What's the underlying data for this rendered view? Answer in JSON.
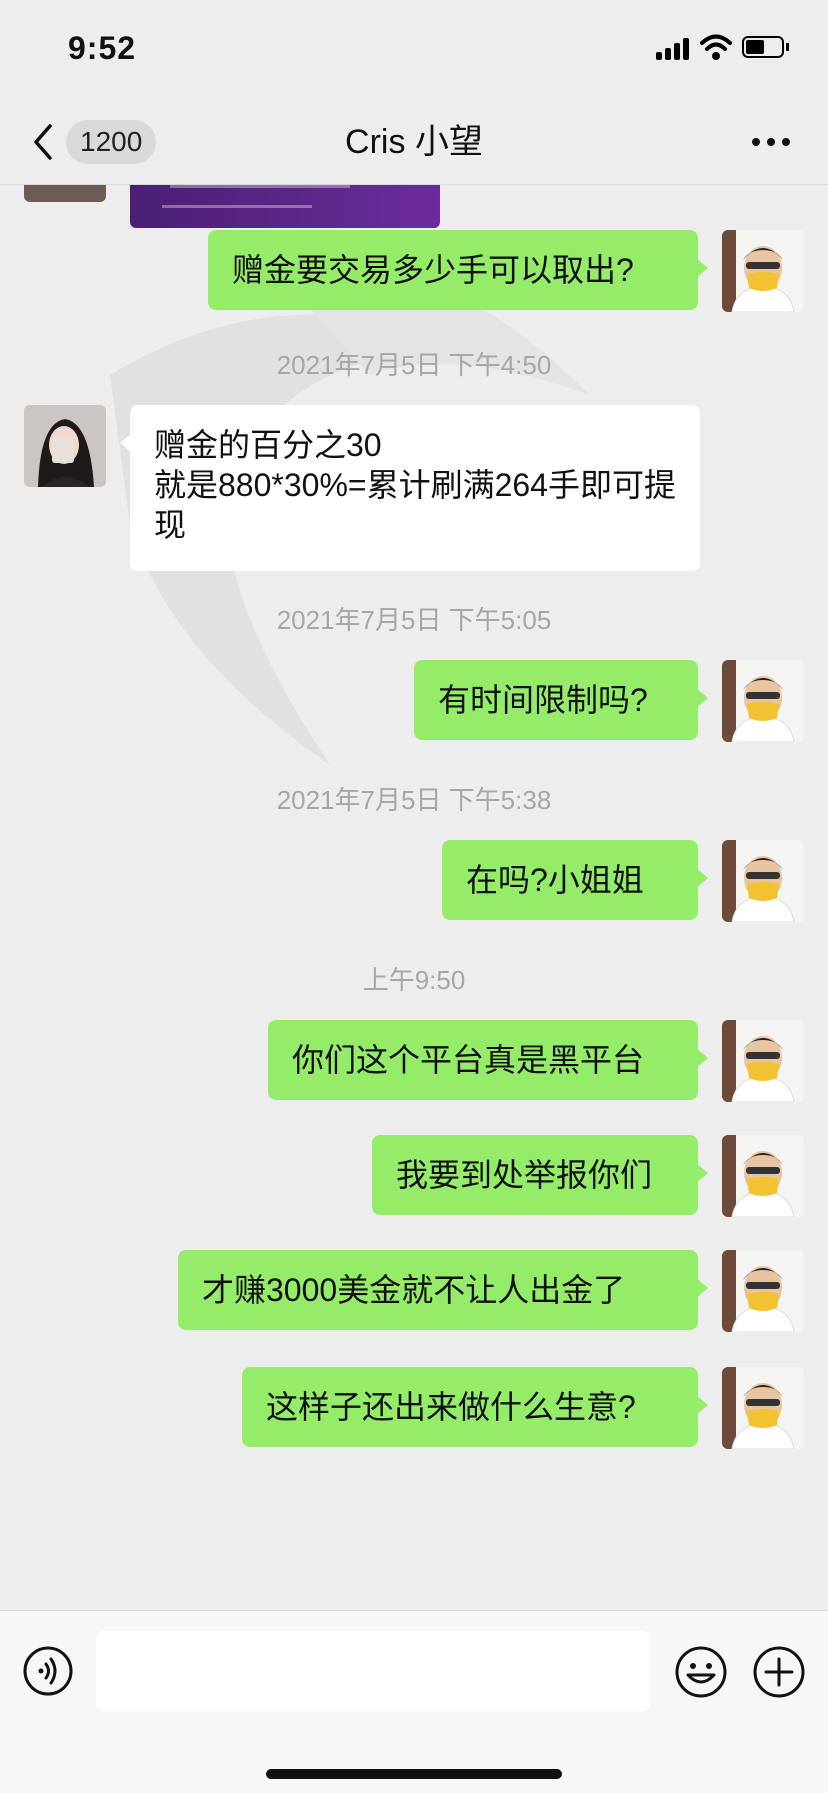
{
  "status_bar": {
    "time": "9:52"
  },
  "nav": {
    "back_count": "1200",
    "title": "Cris 小望"
  },
  "messages": [
    {
      "side": "self",
      "text": "赠金要交易多少手可以取出?"
    },
    {
      "type": "timestamp",
      "text": "2021年7月5日 下午4:50"
    },
    {
      "side": "other",
      "text": "赠金的百分之30\n就是880*30%=累计刷满264手即可提现"
    },
    {
      "type": "timestamp",
      "text": "2021年7月5日 下午5:05"
    },
    {
      "side": "self",
      "text": "有时间限制吗?"
    },
    {
      "type": "timestamp",
      "text": "2021年7月5日 下午5:38"
    },
    {
      "side": "self",
      "text": "在吗?小姐姐"
    },
    {
      "type": "timestamp",
      "text": "上午9:50"
    },
    {
      "side": "self",
      "text": "你们这个平台真是黑平台"
    },
    {
      "side": "self",
      "text": "我要到处举报你们"
    },
    {
      "side": "self",
      "text": "才赚3000美金就不让人出金了"
    },
    {
      "side": "self",
      "text": "这样子还出来做什么生意?"
    }
  ],
  "input": {
    "value": "",
    "placeholder": ""
  },
  "icons": {
    "back": "chevron-left-icon",
    "more": "more-dots-icon",
    "voice": "voice-icon",
    "emoji": "emoji-icon",
    "plus": "plus-icon"
  },
  "colors": {
    "self_bubble": "#95ec69",
    "other_bubble": "#ffffff",
    "background": "#ededed"
  }
}
